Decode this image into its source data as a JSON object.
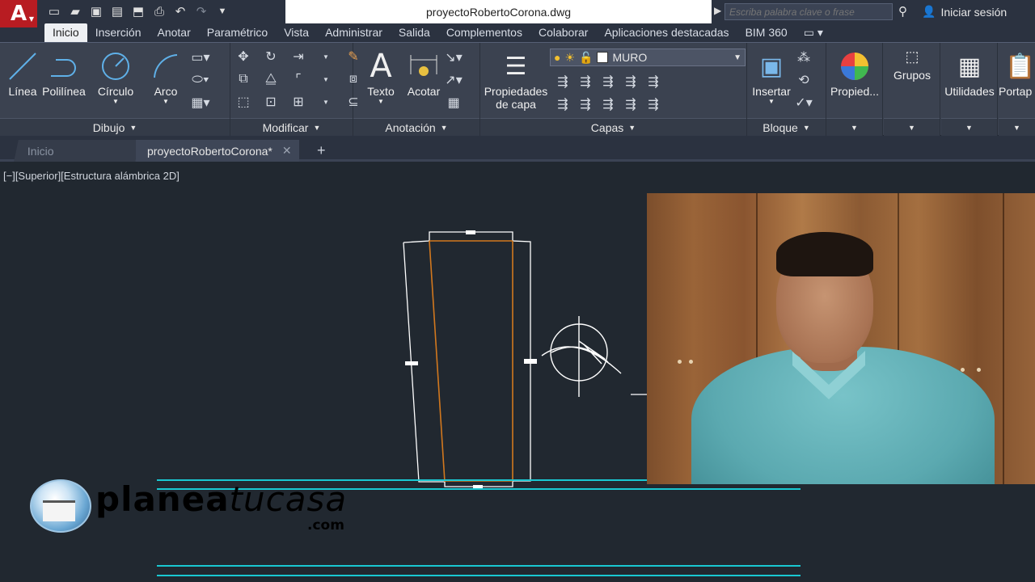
{
  "app": {
    "logo_letter": "A",
    "title": "proyectoRobertoCorona.dwg"
  },
  "quick_access": [
    "new-icon",
    "open-icon",
    "save-icon",
    "save-as-icon",
    "cloud-icon",
    "print-icon",
    "undo-icon",
    "redo-icon",
    "menu-icon"
  ],
  "search": {
    "placeholder": "Escriba palabra clave o frase"
  },
  "account": {
    "signin_label": "Iniciar sesión"
  },
  "ribbon_tabs": [
    "Inicio",
    "Inserción",
    "Anotar",
    "Paramétrico",
    "Vista",
    "Administrar",
    "Salida",
    "Complementos",
    "Colaborar",
    "Aplicaciones destacadas",
    "BIM 360"
  ],
  "panels": {
    "dibujo": {
      "title": "Dibujo",
      "tools": [
        "Línea",
        "Polilínea",
        "Círculo",
        "Arco"
      ]
    },
    "modificar": {
      "title": "Modificar"
    },
    "anotacion": {
      "title": "Anotación",
      "tools": [
        "Texto",
        "Acotar"
      ]
    },
    "capas": {
      "title": "Capas",
      "props_label_1": "Propiedades",
      "props_label_2": "de capa",
      "current_layer": "MURO"
    },
    "bloque": {
      "title": "Bloque",
      "tool": "Insertar"
    },
    "extra": {
      "propied": "Propied...",
      "grupos": "Grupos",
      "utilidades": "Utilidades",
      "portapapeles": "Portap"
    }
  },
  "doc_tabs": {
    "home": "Inicio",
    "file": "proyectoRobertoCorona*"
  },
  "viewport": {
    "label": "[−][Superior][Estructura alámbrica 2D]"
  },
  "brand": {
    "name_bold": "planea",
    "name_italic": "tu",
    "name_end": "casa",
    "tld": ".com"
  },
  "colors": {
    "accent": "#b81c22",
    "drawing_bg": "#212830",
    "line_white": "#ffffff",
    "line_orange": "#d2781e",
    "line_cyan": "#19c8d2"
  }
}
